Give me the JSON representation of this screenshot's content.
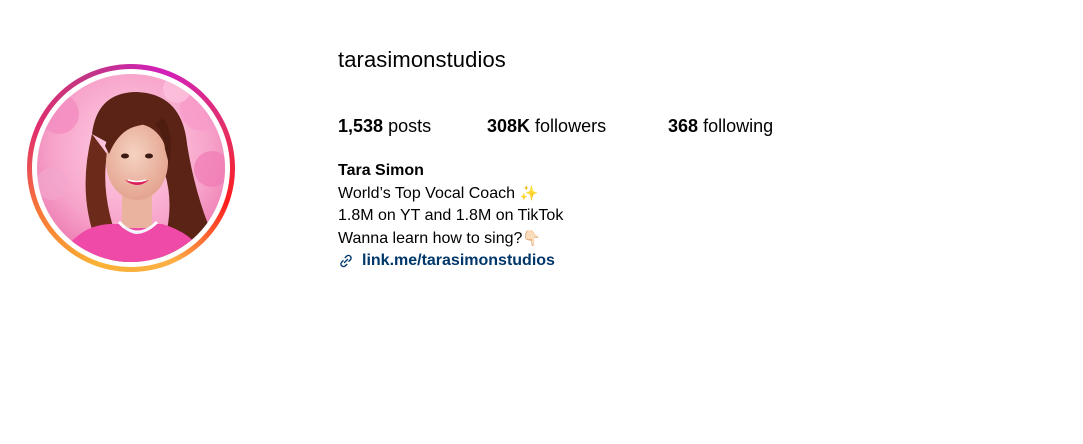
{
  "profile": {
    "username": "tarasimonstudios",
    "stats": {
      "posts_count": "1,538",
      "posts_label": "posts",
      "followers_count": "308K",
      "followers_label": "followers",
      "following_count": "368",
      "following_label": "following"
    },
    "bio": {
      "name": "Tara Simon",
      "line1": "World’s Top Vocal Coach",
      "line1_emoji": "✨",
      "line2": "1.8M on YT and 1.8M on TikTok",
      "line3": "Wanna learn how to sing?",
      "line3_emoji": "👇🏻",
      "link": "link.me/tarasimonstudios"
    },
    "avatar_icon": "profile-photo",
    "link_icon": "link-icon",
    "colors": {
      "link": "#00376b",
      "ring_start": "#f9b233",
      "ring_end": "#d21fbb"
    }
  }
}
